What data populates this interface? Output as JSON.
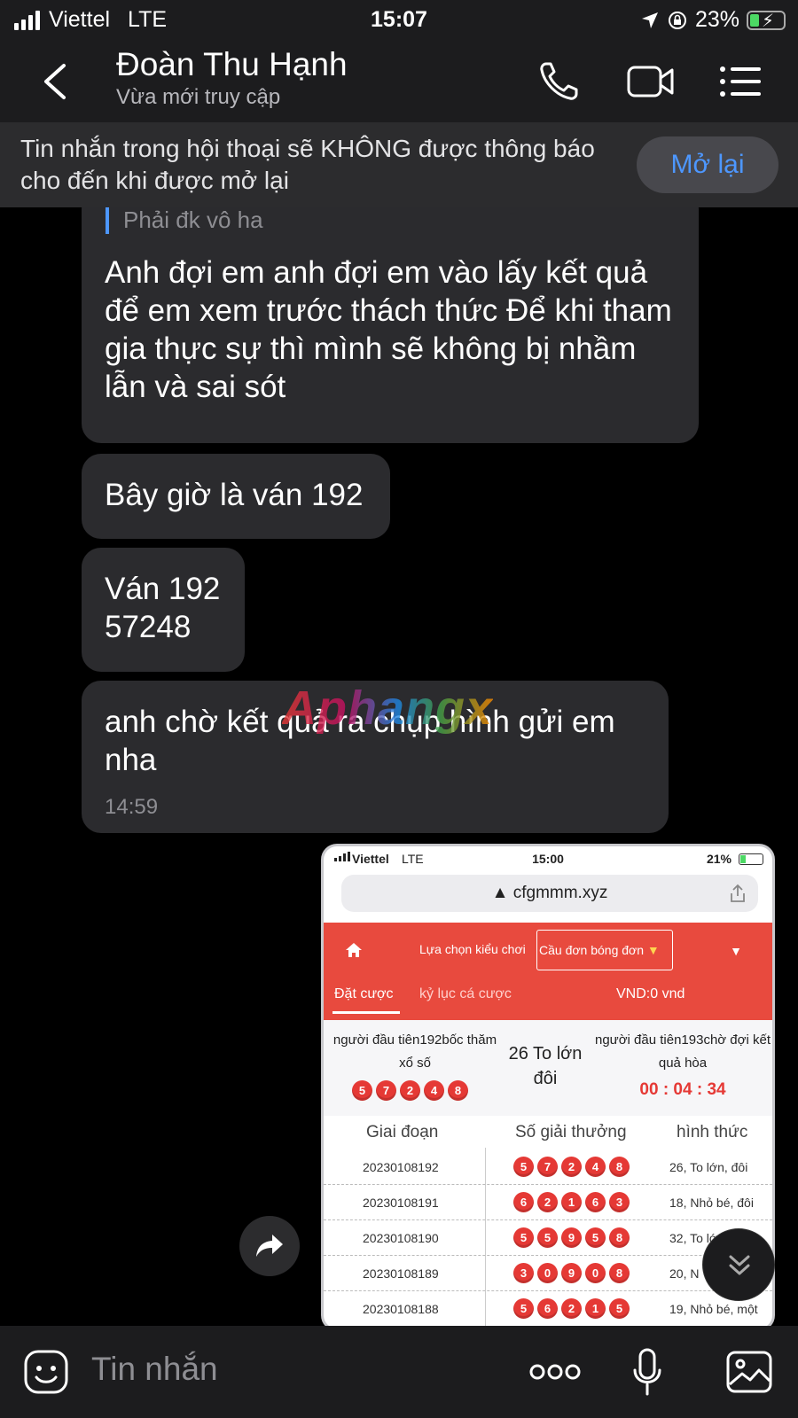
{
  "status_bar": {
    "carrier": "Viettel",
    "network": "LTE",
    "time": "15:07",
    "battery": "23%"
  },
  "header": {
    "contact_name": "Đoàn Thu Hạnh",
    "contact_status": "Vừa mới truy cập",
    "icons": [
      "phone-icon",
      "video-icon",
      "menu-icon"
    ]
  },
  "banner": {
    "text": "Tin nhắn trong hội thoại sẽ KHÔNG được thông báo cho đến khi được mở lại",
    "button_label": "Mở lại"
  },
  "messages": [
    {
      "quote": "Phải đk vô ha",
      "text": "Anh đợi em anh đợi em vào lấy kết quả để em xem trước thách thức Để khi tham gia thực sự thì mình sẽ không bị nhầm lẫn và sai sót"
    },
    {
      "text": "Bây giờ là ván 192"
    },
    {
      "line1": "Ván 192",
      "line2": "57248"
    },
    {
      "text": "anh chờ kết quả ra chụp hình gửi em nha",
      "time": "14:59"
    }
  ],
  "watermark": "Aphangx",
  "attachment": {
    "status_bar": {
      "carrier": "Viettel",
      "network": "LTE",
      "time": "15:00",
      "battery": "21%"
    },
    "url": "cfgmmm.xyz",
    "nav": {
      "label": "Lựa chọn kiểu chơi",
      "selected_game": "Cầu đơn bóng đơn",
      "tab_bet": "Đặt cược",
      "tab_history": "kỷ lục cá cược",
      "balance": "VND:0 vnd"
    },
    "info": {
      "left_text": "người đầu tiên192bốc thăm xổ số",
      "left_balls": [
        "5",
        "7",
        "2",
        "4",
        "8"
      ],
      "center_text": "26 To lớn đôi",
      "right_text": "người đầu tiên193chờ đợi kết quả hòa",
      "countdown": "00 : 04 : 34"
    },
    "table": {
      "headers": [
        "Giai đoạn",
        "Số giải thưởng",
        "hình thức"
      ],
      "rows": [
        {
          "period": "20230108192",
          "balls": [
            "5",
            "7",
            "2",
            "4",
            "8"
          ],
          "type": "26, To lớn, đôi"
        },
        {
          "period": "20230108191",
          "balls": [
            "6",
            "2",
            "1",
            "6",
            "3"
          ],
          "type": "18, Nhỏ bé, đôi"
        },
        {
          "period": "20230108190",
          "balls": [
            "5",
            "5",
            "9",
            "5",
            "8"
          ],
          "type": "32, To lớn, đôi"
        },
        {
          "period": "20230108189",
          "balls": [
            "3",
            "0",
            "9",
            "0",
            "8"
          ],
          "type": "20, N"
        },
        {
          "period": "20230108188",
          "balls": [
            "5",
            "6",
            "2",
            "1",
            "5"
          ],
          "type": "19, Nhỏ bé, một"
        }
      ]
    }
  },
  "composer": {
    "placeholder": "Tin nhắn"
  },
  "colors": {
    "accent_blue": "#4d97ff",
    "bubble_bg": "#2b2b2e",
    "header_bg": "#1c1c1e",
    "site_red": "#e84a3e"
  }
}
